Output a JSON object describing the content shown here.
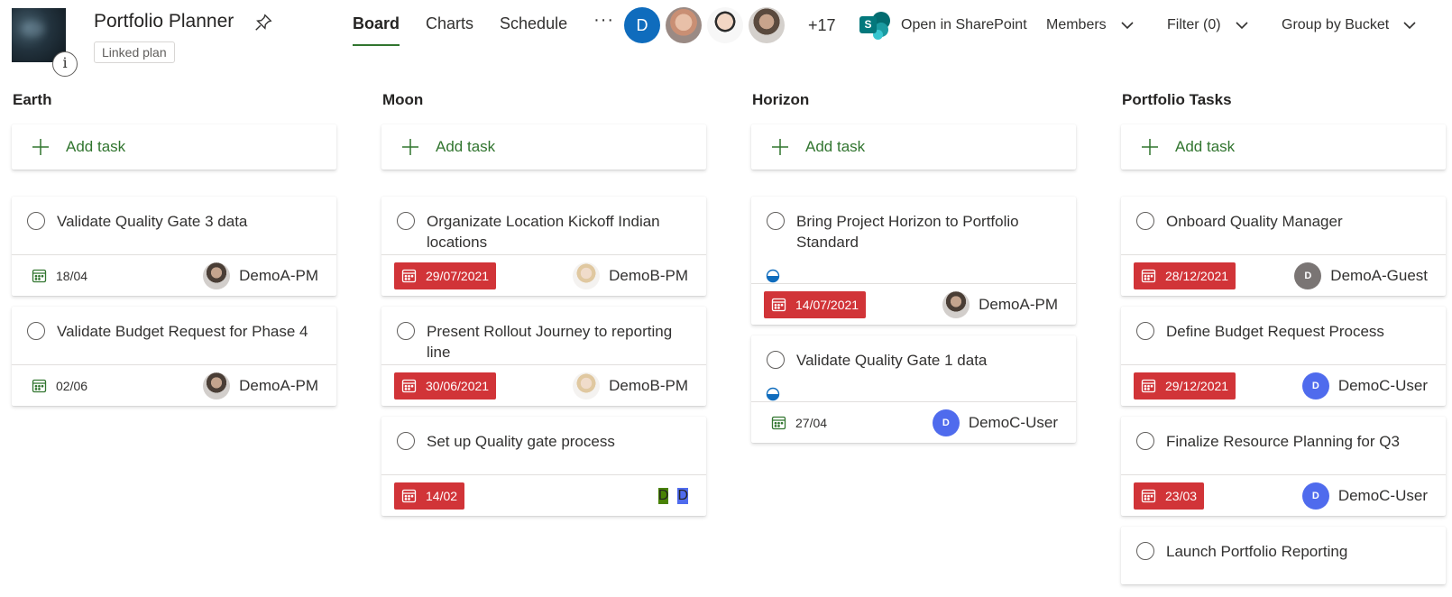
{
  "header": {
    "plan_title": "Portfolio Planner",
    "linked_badge": "Linked plan",
    "tabs": [
      {
        "label": "Board",
        "active": true
      },
      {
        "label": "Charts",
        "active": false
      },
      {
        "label": "Schedule",
        "active": false
      }
    ],
    "more_label": "···",
    "member_initial": "D",
    "extra_members": "+17",
    "sharepoint_label": "Open in SharePoint",
    "sharepoint_glyph": "S",
    "members_label": "Members",
    "filter_label": "Filter (0)",
    "group_label": "Group by Bucket",
    "info_glyph": "i"
  },
  "colors": {
    "accent_green": "#31752f",
    "late_red": "#d13438",
    "avatar_blue": "#0f6cbd",
    "user_purple_blue": "#4f6bed"
  },
  "add_task_label": "Add task",
  "buckets": [
    {
      "name": "Earth",
      "tasks": [
        {
          "title": "Validate Quality Gate 3 data",
          "date": "18/04",
          "late": false,
          "assignee": "DemoA-PM"
        },
        {
          "title": "Validate Budget Request for Phase 4",
          "date": "02/06",
          "late": false,
          "assignee": "DemoA-PM"
        }
      ]
    },
    {
      "name": "Moon",
      "tasks": [
        {
          "title": "Organizate Location Kickoff Indian locations",
          "date": "29/07/2021",
          "late": true,
          "assignee": "DemoB-PM"
        },
        {
          "title": "Present Rollout Journey to reporting line",
          "date": "30/06/2021",
          "late": true,
          "assignee": "DemoB-PM"
        },
        {
          "title": "Set up Quality gate process",
          "date": "14/02",
          "late": true,
          "assignee_initials": [
            "D",
            "D"
          ]
        }
      ]
    },
    {
      "name": "Horizon",
      "tasks": [
        {
          "title": "Bring Project Horizon to Portfolio Standard",
          "progress": "in-progress",
          "date": "14/07/2021",
          "late": true,
          "assignee": "DemoA-PM"
        },
        {
          "title": "Validate Quality Gate 1 data",
          "progress": "in-progress",
          "date": "27/04",
          "late": false,
          "assignee": "DemoC-User",
          "assignee_initial": "D"
        }
      ]
    },
    {
      "name": "Portfolio Tasks",
      "tasks": [
        {
          "title": "Onboard Quality Manager",
          "date": "28/12/2021",
          "late": true,
          "assignee": "DemoA-Guest",
          "assignee_initial": "D"
        },
        {
          "title": "Define Budget Request Process",
          "date": "29/12/2021",
          "late": true,
          "assignee": "DemoC-User",
          "assignee_initial": "D"
        },
        {
          "title": "Finalize Resource Planning for Q3",
          "date": "23/03",
          "late": true,
          "assignee": "DemoC-User",
          "assignee_initial": "D"
        },
        {
          "title": "Launch Portfolio Reporting"
        }
      ]
    }
  ]
}
